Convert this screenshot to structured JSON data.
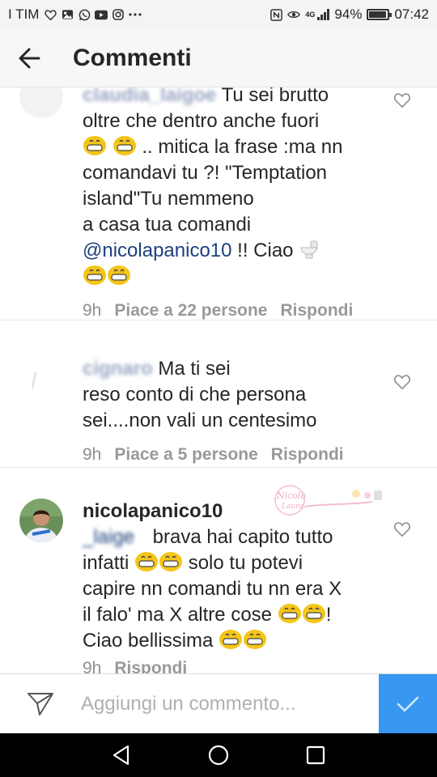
{
  "status_bar": {
    "carrier": "I TIM",
    "network": "4G",
    "battery": "94%",
    "battery_level": 0.94,
    "time": "07:42",
    "icons": [
      "heart-icon",
      "gallery-icon",
      "whatsapp-icon",
      "youtube-icon",
      "instagram-icon",
      "more-icon",
      "nfc-icon",
      "eye-icon",
      "signal-icon",
      "battery-icon"
    ]
  },
  "header": {
    "title": "Commenti",
    "back_icon": "arrow-left-icon"
  },
  "comments": [
    {
      "username": "claudia_laigoe",
      "lines": [
        "Tu sei brutto",
        "oltre che dentro anche fuori",
        ".. mitica la frase :ma nn",
        "comandavi tu ?! \"Temptation",
        "island\"Tu nemmeno",
        "a casa tua comandi",
        "@nicolapanico10",
        " !! Ciao "
      ],
      "time": "9h",
      "likes": "Piace a 22 persone",
      "reply": "Rispondi"
    },
    {
      "username": "cignaro",
      "lines": [
        "Ma ti sei",
        "reso conto di che persona",
        "sei....non vali un centesimo"
      ],
      "time": "9h",
      "likes": "Piace a 5 persone",
      "reply": "Rispondi"
    },
    {
      "username": "nicolapanico10",
      "mention_partial": "_laige",
      "lines": [
        "brava hai capito tutto",
        "infatti ",
        " solo tu potevi",
        "capire nn comandi tu nn era X",
        "il falo' ma X altre cose ",
        "!",
        "Ciao bellissima "
      ],
      "time": "9h",
      "reply": "Rispondi"
    }
  ],
  "watermark_text": "Nicolò Laura",
  "input": {
    "placeholder": "Aggiungi un commento...",
    "value": ""
  },
  "colors": {
    "accent": "#3897f0",
    "mention": "#1c3f7d",
    "meta": "#8e8e8e"
  }
}
